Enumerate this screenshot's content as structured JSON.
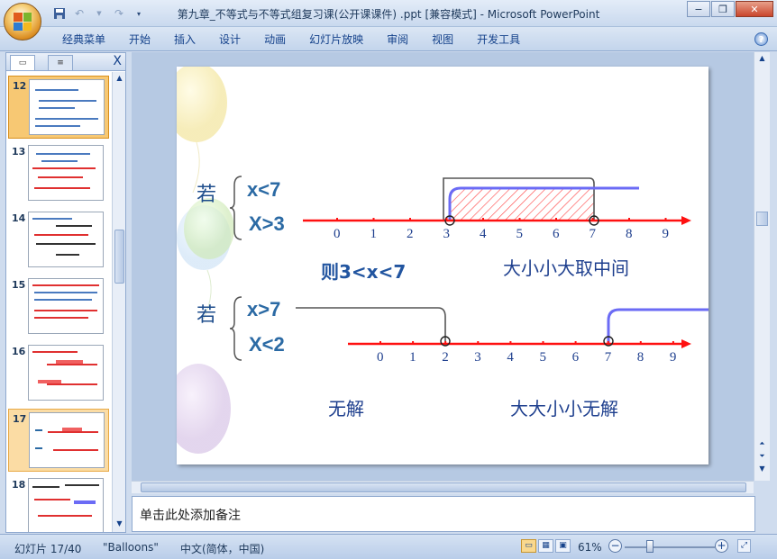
{
  "window": {
    "title": "第九章_不等式与不等式组复习课(公开课课件) .ppt [兼容模式] - Microsoft PowerPoint",
    "minimize": "−",
    "restore": "❐",
    "close": "✕"
  },
  "ribbon": {
    "tabs": [
      "经典菜单",
      "开始",
      "插入",
      "设计",
      "动画",
      "幻灯片放映",
      "审阅",
      "视图",
      "开发工具"
    ],
    "help": "?"
  },
  "left_panel": {
    "tab_slides": "▭",
    "tab_outline": "≡",
    "close": "X",
    "thumbnails": [
      {
        "num": "12",
        "state": "selected"
      },
      {
        "num": "13",
        "state": "normal"
      },
      {
        "num": "14",
        "state": "normal"
      },
      {
        "num": "15",
        "state": "normal"
      },
      {
        "num": "16",
        "state": "normal"
      },
      {
        "num": "17",
        "state": "current"
      },
      {
        "num": "18",
        "state": "normal"
      }
    ]
  },
  "slide": {
    "ex1": {
      "ruo": "若",
      "ineq1": "x<7",
      "ineq2": "X>3",
      "ticks": [
        "0",
        "1",
        "2",
        "3",
        "4",
        "5",
        "6",
        "7",
        "8",
        "9"
      ],
      "conclusion": "则3<x<7",
      "rule": "大小小大取中间"
    },
    "ex2": {
      "ruo": "若",
      "ineq1": "x>7",
      "ineq2": "X<2",
      "ticks": [
        "0",
        "1",
        "2",
        "3",
        "4",
        "5",
        "6",
        "7",
        "8",
        "9"
      ],
      "conclusion": "无解",
      "rule": "大大小小无解"
    },
    "colors": {
      "axis": "#ff1010",
      "blue_line": "#6b6bf5",
      "gray_line": "#555555",
      "hatch": "#ff4040"
    }
  },
  "notes": {
    "placeholder": "单击此处添加备注"
  },
  "status": {
    "slide": "幻灯片 17/40",
    "theme": "\"Balloons\"",
    "language": "中文(简体，中国)",
    "zoom": "61%"
  }
}
